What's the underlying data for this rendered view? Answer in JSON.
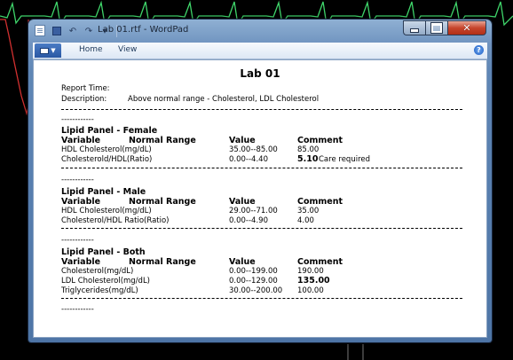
{
  "window": {
    "title": "Lab 01.rtf - WordPad",
    "qat_icons": [
      "save-icon",
      "undo-icon",
      "redo-icon",
      "customize-icon"
    ],
    "minimize_icon": "minimize-icon",
    "maximize_icon": "maximize-icon",
    "close_icon": "close-icon"
  },
  "ribbon": {
    "tabs": [
      "Home",
      "View"
    ],
    "help_glyph": "?"
  },
  "document": {
    "title": "Lab 01",
    "report_time_label": "Report Time:",
    "report_time_value": "",
    "description_label": "Description:",
    "description_value": "Above normal range - Cholesterol, LDL Cholesterol",
    "separator_short": "------------",
    "sections": [
      {
        "title": "Lipid Panel - Female",
        "headers": [
          "Variable",
          "Normal Range",
          "Value",
          "Comment"
        ],
        "rows": [
          {
            "variable": "HDL Cholesterol(mg/dL)",
            "value": "35.00--85.00",
            "comment": "85.00",
            "comment_bold": false,
            "note": ""
          },
          {
            "variable": "Cholesterold/HDL(Ratio)",
            "value": "0.00--4.40",
            "comment": "5.10",
            "comment_bold": true,
            "note": "Care required"
          }
        ]
      },
      {
        "title": "Lipid Panel - Male",
        "headers": [
          "Variable",
          "Normal Range",
          "Value",
          "Comment"
        ],
        "rows": [
          {
            "variable": "HDL Cholesterol(mg/dL)",
            "value": "29.00--71.00",
            "comment": "35.00",
            "comment_bold": false,
            "note": ""
          },
          {
            "variable": "Cholesterol/HDL Ratio(Ratio)",
            "value": "0.00--4.90",
            "comment": "4.00",
            "comment_bold": false,
            "note": ""
          }
        ]
      },
      {
        "title": "Lipid Panel - Both",
        "headers": [
          "Variable",
          "Normal Range",
          "Value",
          "Comment"
        ],
        "rows": [
          {
            "variable": "Cholesterol(mg/dL)",
            "value": "0.00--199.00",
            "comment": "190.00",
            "comment_bold": false,
            "note": ""
          },
          {
            "variable": "LDL Cholesterol(mg/dL)",
            "value": "0.00--129.00",
            "comment": "135.00",
            "comment_bold": true,
            "note": ""
          },
          {
            "variable": "Triglycerides(mg/dL)",
            "value": "30.00--200.00",
            "comment": "100.00",
            "comment_bold": false,
            "note": ""
          }
        ]
      }
    ]
  },
  "colors": {
    "desktop": "#000000",
    "ecg_trace": "#3fd46a",
    "ecg_trace_red": "#d23030",
    "window_frame": "#6f93bf",
    "close_button": "#c7452c"
  }
}
